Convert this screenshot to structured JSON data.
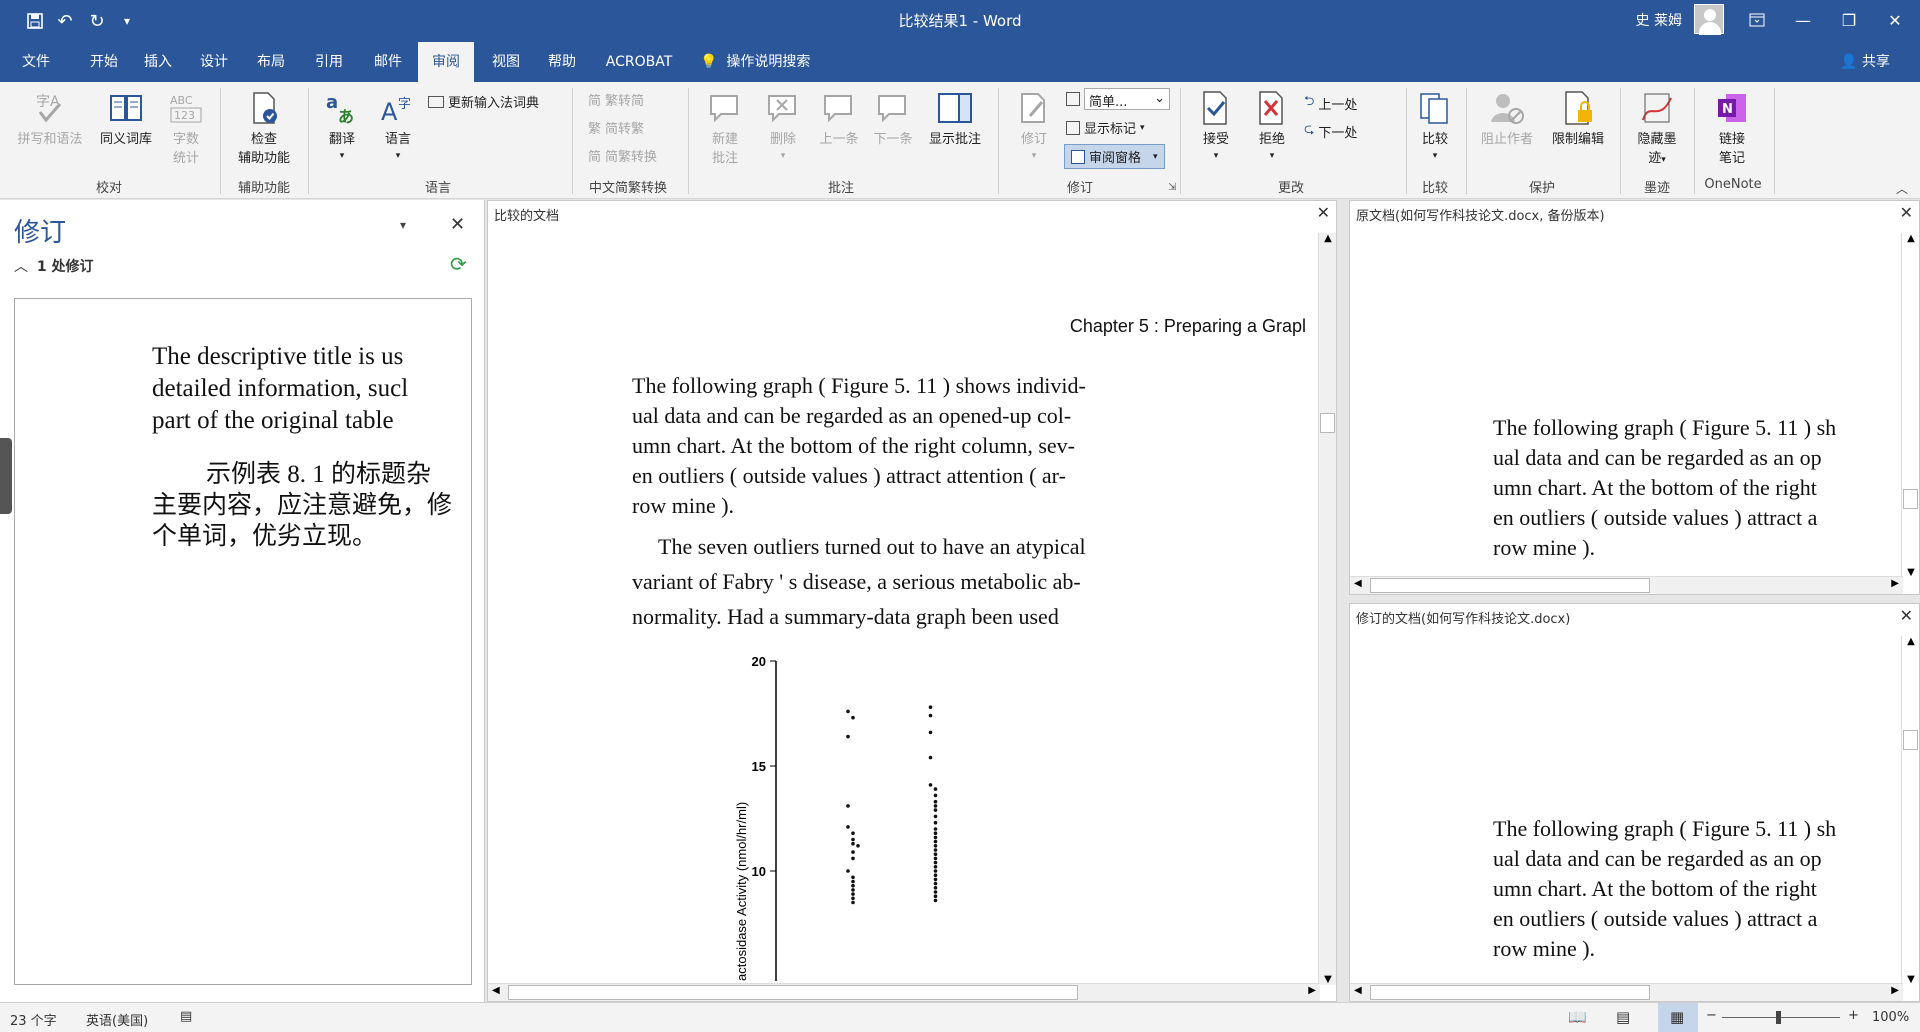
{
  "window": {
    "title": "比较结果1 - Word",
    "user": "史 莱姆",
    "controls": [
      "—",
      "❐",
      "✕"
    ]
  },
  "tabs": [
    {
      "label": "文件"
    },
    {
      "label": "开始"
    },
    {
      "label": "插入"
    },
    {
      "label": "设计"
    },
    {
      "label": "布局"
    },
    {
      "label": "引用"
    },
    {
      "label": "邮件"
    },
    {
      "label": "审阅",
      "active": true
    },
    {
      "label": "视图"
    },
    {
      "label": "帮助"
    },
    {
      "label": "ACROBAT"
    }
  ],
  "tell_me": "操作说明搜索",
  "share": "共享",
  "ribbon": {
    "proofing": {
      "spelling": "拼写和语法",
      "thesaurus": "同义词库",
      "wordcount1": "字数",
      "wordcount2": "统计",
      "group": "校对"
    },
    "accessibility": {
      "check1": "检查",
      "check2": "辅助功能",
      "group": "辅助功能"
    },
    "language": {
      "translate": "翻译",
      "language": "语言",
      "update_ime": "更新输入法词典",
      "group": "语言"
    },
    "chinese": {
      "to_trad": "繁转简",
      "to_simp": "简转繁",
      "convert": "简繁转换",
      "group": "中文简繁转换"
    },
    "comments": {
      "new1": "新建",
      "new2": "批注",
      "delete": "删除",
      "prev": "上一条",
      "next": "下一条",
      "show": "显示批注",
      "group": "批注"
    },
    "tracking": {
      "track": "修订",
      "view_select": "简单...",
      "show_markup": "显示标记",
      "review_pane": "审阅窗格",
      "group": "修订"
    },
    "changes": {
      "accept": "接受",
      "reject": "拒绝",
      "prev": "上一处",
      "next": "下一处",
      "group": "更改"
    },
    "compare": {
      "compare": "比较",
      "group": "比较"
    },
    "protect": {
      "block": "阻止作者",
      "restrict": "限制编辑",
      "group": "保护"
    },
    "ink": {
      "hide1": "隐藏墨",
      "hide2": "迹",
      "group": "墨迹"
    },
    "onenote": {
      "link1": "链接",
      "link2": "笔记",
      "group": "OneNote"
    }
  },
  "revisions_pane": {
    "title": "修订",
    "count": "1 处修订",
    "preview_en": [
      "The descriptive title is us",
      "detailed information, sucl",
      "part of the original table"
    ],
    "preview_cn": [
      "示例表 8. 1 的标题杂",
      "主要内容，应注意避免，修",
      "个单词，优劣立现。"
    ]
  },
  "compared_doc": {
    "title": "比较的文档",
    "header": "Chapter 5 : Preparing a Grapl",
    "para1": [
      "The following graph ( Figure 5. 11 ) shows individ-",
      "ual data and can be regarded as an opened-up col-",
      "umn chart. At the bottom of the right column, sev-",
      "en outliers ( outside values ) attract attention ( ar-",
      "row mine )."
    ],
    "para2": [
      "The seven outliers turned out to have an atypical",
      "variant of Fabry ' s disease, a serious metabolic ab-",
      "normality. Had a summary-data graph been used"
    ],
    "chart_data": {
      "type": "scatter",
      "ylabel": "actosidase Activity (nmol/hr/ml)",
      "yticks": [
        20,
        15,
        10
      ],
      "ylim": [
        8,
        20
      ],
      "series": [
        {
          "y": [
            17.6,
            17.3,
            16.4,
            13.1,
            12.1,
            11.8,
            11.5,
            11.3,
            11.2,
            10.9,
            10.6,
            10.0,
            9.7,
            9.5,
            9.3,
            9.1,
            8.9,
            8.7,
            8.5
          ]
        },
        {
          "y": [
            17.8,
            17.4,
            16.6,
            15.4,
            14.1,
            13.9,
            13.6,
            13.3,
            13.1,
            12.9,
            12.6,
            12.3,
            12.0,
            11.8,
            11.6,
            11.4,
            11.2,
            11.0,
            10.8,
            10.6,
            10.4,
            10.2,
            10.0,
            9.8,
            9.6,
            9.4,
            9.2,
            9.0,
            8.8,
            8.6
          ]
        }
      ]
    }
  },
  "original_doc": {
    "title": "原文档(如何写作科技论文.docx, 备份版本)",
    "lines": [
      "The following graph ( Figure 5. 11 ) sh",
      "ual data and can be regarded as an op",
      "umn chart. At the bottom of the right",
      "en outliers ( outside values ) attract a",
      "row mine )."
    ]
  },
  "revised_doc": {
    "title": "修订的文档(如何写作科技论文.docx)",
    "lines": [
      "The following graph ( Figure 5. 11 ) sh",
      "ual data and can be regarded as an op",
      "umn chart. At the bottom of the right",
      "en outliers ( outside values ) attract a",
      "row mine )."
    ]
  },
  "status": {
    "words": "23 个字",
    "lang": "英语(美国)",
    "zoom": "100%"
  }
}
